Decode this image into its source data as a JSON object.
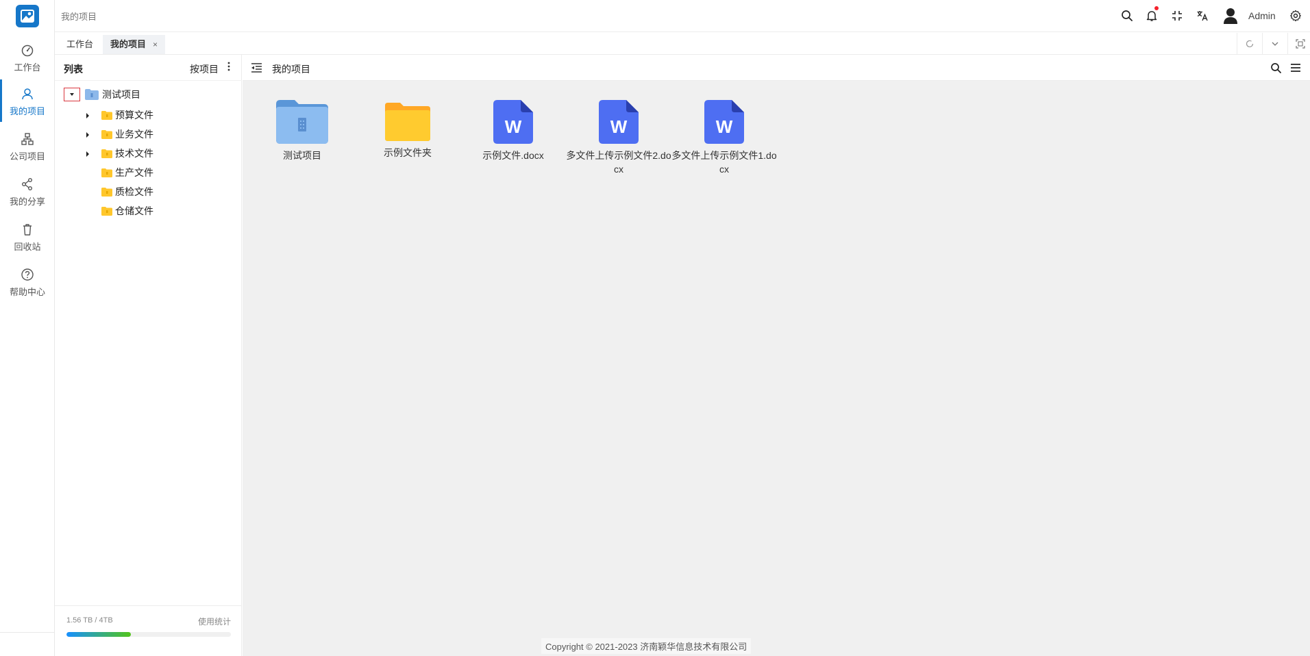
{
  "header": {
    "title": "我的项目",
    "user_name": "Admin",
    "brand_color": "#1677c9"
  },
  "nav": {
    "items": [
      {
        "label": "工作台",
        "icon": "dashboard-icon"
      },
      {
        "label": "我的项目",
        "icon": "user-icon",
        "active": true
      },
      {
        "label": "公司项目",
        "icon": "org-chart-icon"
      },
      {
        "label": "我的分享",
        "icon": "share-icon"
      },
      {
        "label": "回收站",
        "icon": "trash-icon"
      },
      {
        "label": "帮助中心",
        "icon": "help-icon"
      }
    ]
  },
  "tabs": {
    "items": [
      {
        "label": "工作台"
      },
      {
        "label": "我的项目",
        "active": true,
        "close": "×"
      }
    ]
  },
  "tree": {
    "title": "列表",
    "sort_label": "按项目",
    "root": {
      "label": "测试项目",
      "expanded": true
    },
    "children": [
      {
        "label": "预算文件",
        "has_children": true
      },
      {
        "label": "业务文件",
        "has_children": true
      },
      {
        "label": "技术文件",
        "has_children": true
      },
      {
        "label": "生产文件",
        "has_children": false
      },
      {
        "label": "质检文件",
        "has_children": false
      },
      {
        "label": "仓储文件",
        "has_children": false
      }
    ],
    "storage": {
      "usage_text": "1.56 TB / 4TB",
      "link_label": "使用统计",
      "used_fraction": 0.39
    }
  },
  "main": {
    "title": "我的项目",
    "files": [
      {
        "name": "测试项目",
        "type": "project-folder"
      },
      {
        "name": "示例文件夹",
        "type": "folder"
      },
      {
        "name": "示例文件.docx",
        "type": "word"
      },
      {
        "name": "多文件上传示例文件2.docx",
        "type": "word"
      },
      {
        "name": "多文件上传示例文件1.docx",
        "type": "word"
      }
    ],
    "word_glyph": "W",
    "copyright": "Copyright © 2021-2023 济南颖华信息技术有限公司"
  }
}
